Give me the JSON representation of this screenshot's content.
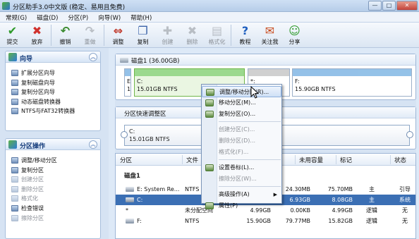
{
  "window": {
    "title": "分区助手3.0中文版 (稳定、易用且免费)",
    "btn_min": "—",
    "btn_max": "□",
    "btn_close": "✕"
  },
  "menubar": [
    "常规(G)",
    "磁盘(D)",
    "分区(P)",
    "向导(W)",
    "帮助(H)"
  ],
  "toolbar": [
    {
      "label": "提交",
      "icon": "check-icon",
      "glyph": "✔",
      "color": "#2f9a2a",
      "enabled": true
    },
    {
      "label": "放弃",
      "icon": "discard-icon",
      "glyph": "✖",
      "color": "#d0312d",
      "enabled": true
    },
    {
      "label": "撤销",
      "icon": "undo-icon",
      "glyph": "↶",
      "color": "#3a8a2e",
      "enabled": true
    },
    {
      "label": "重做",
      "icon": "redo-icon",
      "glyph": "↷",
      "color": "#7a7f85",
      "enabled": false
    },
    {
      "label": "调整",
      "icon": "resize-icon",
      "glyph": "⇔",
      "color": "#c0392b",
      "enabled": true
    },
    {
      "label": "复制",
      "icon": "copy-icon",
      "glyph": "❐",
      "color": "#3a62a8",
      "enabled": true
    },
    {
      "label": "创建",
      "icon": "create-icon",
      "glyph": "✚",
      "color": "#7a7f85",
      "enabled": false
    },
    {
      "label": "删除",
      "icon": "delete-icon",
      "glyph": "✖",
      "color": "#7a7f85",
      "enabled": false
    },
    {
      "label": "格式化",
      "icon": "format-icon",
      "glyph": "▤",
      "color": "#7a7f85",
      "enabled": false
    },
    {
      "label": "教程",
      "icon": "help-icon",
      "glyph": "?",
      "color": "#1f5fbf",
      "enabled": true
    },
    {
      "label": "关注我",
      "icon": "follow-icon",
      "glyph": "✉",
      "color": "#c94a1c",
      "enabled": true
    },
    {
      "label": "分享",
      "icon": "share-icon",
      "glyph": "☺",
      "color": "#2f9a2a",
      "enabled": true
    }
  ],
  "wizard": {
    "title": "向导",
    "items": [
      "扩展分区向导",
      "复制磁盘向导",
      "复制分区向导",
      "动态磁盘转换器",
      "NTFS与FAT32转换器"
    ]
  },
  "ops": {
    "title": "分区操作",
    "items": [
      {
        "label": "调整/移动分区",
        "enabled": true
      },
      {
        "label": "复制分区",
        "enabled": true
      },
      {
        "label": "创建分区",
        "enabled": false
      },
      {
        "label": "删除分区",
        "enabled": false
      },
      {
        "label": "格式化",
        "enabled": false
      },
      {
        "label": "检查错误",
        "enabled": true
      },
      {
        "label": "擦除分区",
        "enabled": false
      }
    ]
  },
  "disk1": {
    "title": "磁盘1 (36.00GB)",
    "parts": [
      {
        "l1": "E",
        "l2": "1",
        "used": 0.6,
        "color": "#3d8fd6"
      },
      {
        "l1": "C:",
        "l2": "15.01GB NTFS",
        "used": 0.46,
        "color": "#5bc34a",
        "selected": true
      },
      {
        "l1": "*:",
        "l2": "4.99...",
        "used": 0,
        "color": "#aaaaaa"
      },
      {
        "l1": "F:",
        "l2": "15.90GB NTFS",
        "used": 0.02,
        "color": "#3d8fd6"
      }
    ]
  },
  "quick": {
    "title": "分区快速调整区",
    "l1": "C:",
    "l2": "15.01GB NTFS"
  },
  "table": {
    "headers": [
      "分区",
      "文件",
      "已用容量",
      "未用容量",
      "标记",
      "状态"
    ],
    "disk": "磁盘1",
    "rows": [
      {
        "part": "E:  System Re...",
        "fs": "NTFS",
        "cap": "",
        "used": "24.30MB",
        "free": "75.70MB",
        "flag": "主",
        "status": "引导",
        "selected": false
      },
      {
        "part": "C:",
        "fs": "",
        "cap": "",
        "used": "6.93GB",
        "free": "8.08GB",
        "flag": "主",
        "status": "系统",
        "selected": true
      },
      {
        "part": "*",
        "fs": "未分配空间",
        "cap": "4.99GB",
        "used": "0.00KB",
        "free": "4.99GB",
        "flag": "逻辑",
        "status": "无",
        "selected": false
      },
      {
        "part": "F:",
        "fs": "NTFS",
        "cap": "15.90GB",
        "used": "79.77MB",
        "free": "15.82GB",
        "flag": "逻辑",
        "status": "无",
        "selected": false
      }
    ]
  },
  "context_menu": [
    {
      "label": "调整/移动分区(R)...",
      "enabled": true,
      "highlight": true,
      "icon": true
    },
    {
      "label": "移动分区(M)...",
      "enabled": true,
      "icon": true
    },
    {
      "label": "复制分区(O)...",
      "enabled": true,
      "icon": true
    },
    {
      "sep": true
    },
    {
      "label": "创建分区(C)...",
      "enabled": false
    },
    {
      "label": "删除分区(D)...",
      "enabled": false
    },
    {
      "label": "格式化(F)...",
      "enabled": false
    },
    {
      "sep": true
    },
    {
      "label": "设置卷标(L)...",
      "enabled": true,
      "icon": true
    },
    {
      "label": "擦除分区(W)...",
      "enabled": false
    },
    {
      "sep": true
    },
    {
      "label": "高级操作(A)",
      "enabled": true,
      "submenu": true
    },
    {
      "label": "属性(P)",
      "enabled": true,
      "icon": true
    }
  ]
}
